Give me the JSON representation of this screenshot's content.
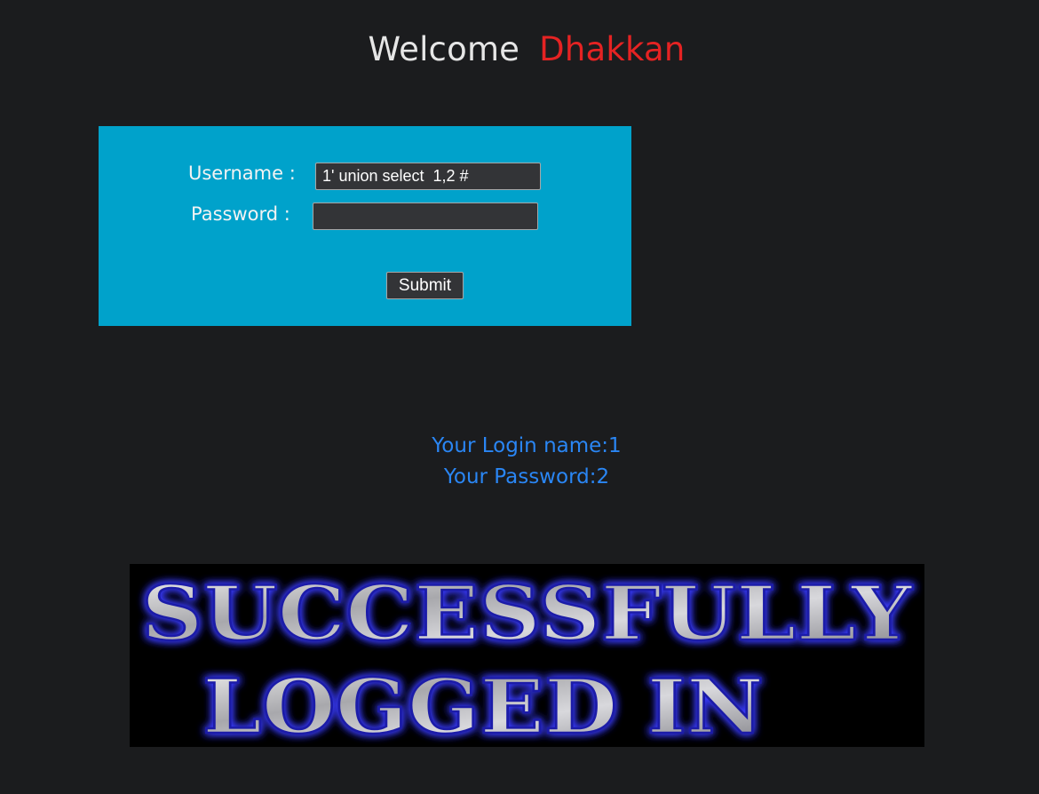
{
  "header": {
    "welcome_text": "Welcome",
    "user_name": "Dhakkan"
  },
  "login_form": {
    "username_label": "Username :",
    "username_value": "1' union select  1,2 #",
    "password_label": "Password :",
    "password_value": "",
    "submit_label": "Submit"
  },
  "result": {
    "login_name_line": "Your Login name:1",
    "password_line": "Your Password:2"
  },
  "banner": {
    "line1": "SUCCESSFULLY",
    "line2": "LOGGED IN"
  },
  "colors": {
    "background": "#1b1c1e",
    "panel": "#00a2cb",
    "accent_red": "#e52323",
    "result_blue": "#2a86f4"
  }
}
